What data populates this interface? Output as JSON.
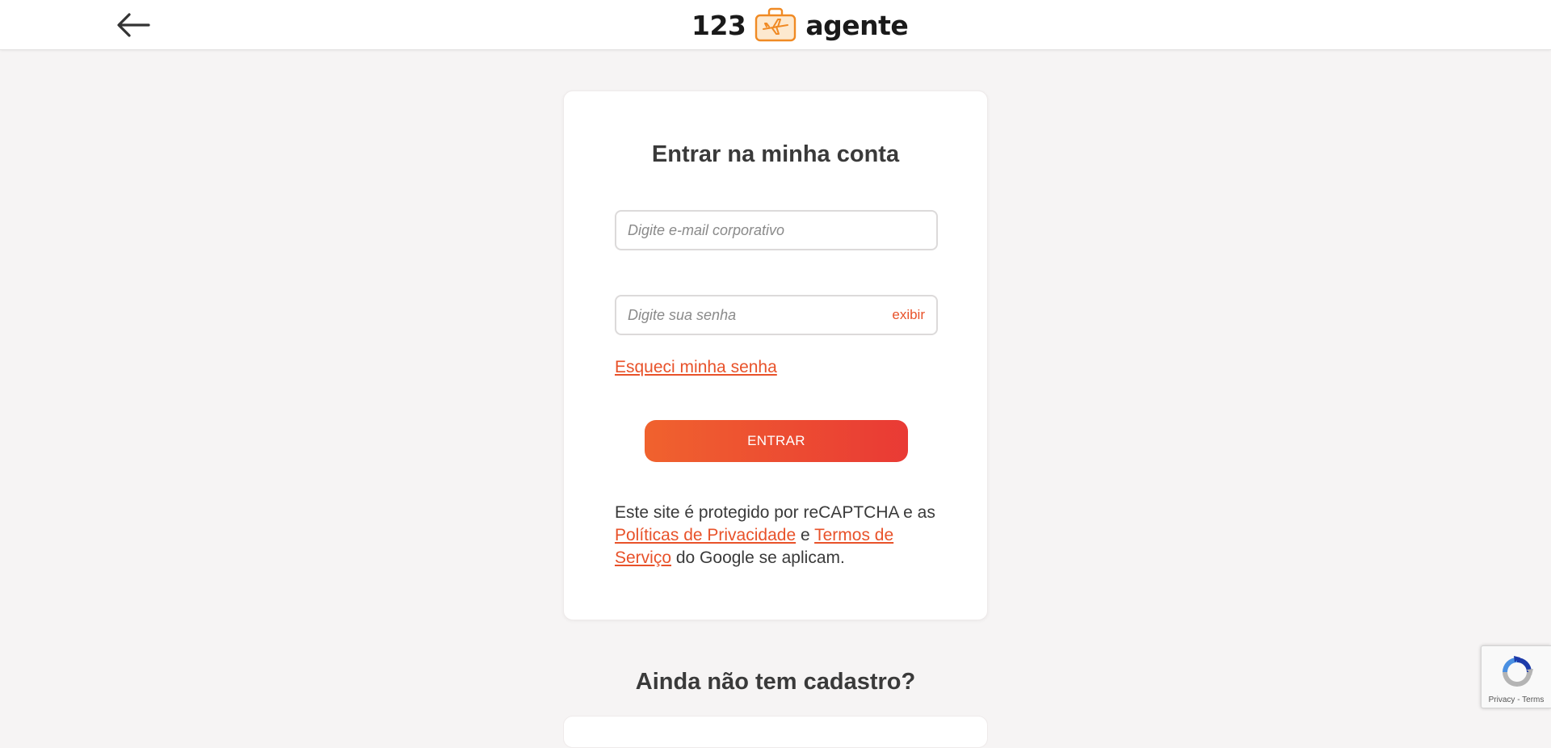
{
  "header": {
    "logo_prefix": "123",
    "logo_suffix": "agente",
    "back_icon": "arrow-left-icon",
    "logo_icon": "suitcase-airplane-icon",
    "brand_color": "#f08a24"
  },
  "login": {
    "title": "Entrar na minha conta",
    "email_placeholder": "Digite e-mail corporativo",
    "password_placeholder": "Digite sua senha",
    "show_password_label": "exibir",
    "forgot_password_label": "Esqueci minha senha",
    "submit_label": "ENTRAR",
    "accent_color": "#e8522a"
  },
  "recaptcha_notice": {
    "text_before": "Este site é protegido por reCAPTCHA e as ",
    "privacy_link": "Políticas de Privacidade",
    "text_middle": " e ",
    "terms_link": "Termos de Serviço",
    "text_after": " do Google se aplicam."
  },
  "signup": {
    "title": "Ainda não tem cadastro?"
  },
  "recaptcha_badge": {
    "privacy": "Privacy",
    "separator": " - ",
    "terms": "Terms",
    "icon": "recaptcha-icon"
  }
}
